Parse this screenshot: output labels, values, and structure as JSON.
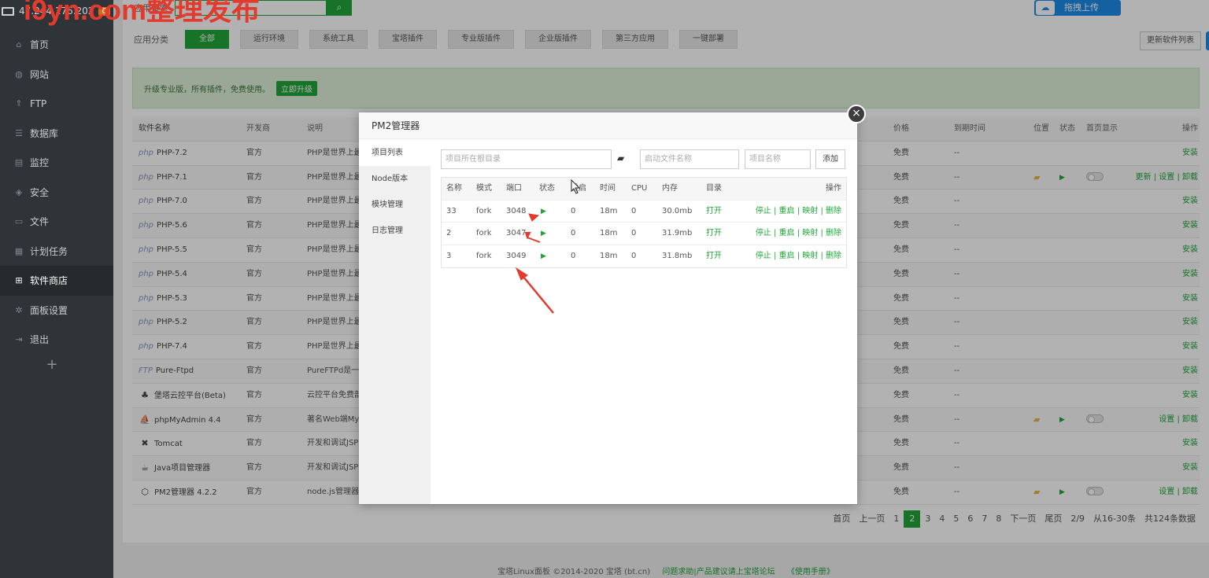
{
  "header": {
    "ip": "47.244.176.202",
    "badge": "0",
    "watermark": "i9yn.com整理发布"
  },
  "sidebar": {
    "items": [
      {
        "label": "首页",
        "icon": "home-icon",
        "glyph": "⌂"
      },
      {
        "label": "网站",
        "icon": "globe-icon",
        "glyph": "◍"
      },
      {
        "label": "FTP",
        "icon": "ftp-icon",
        "glyph": "⇑"
      },
      {
        "label": "数据库",
        "icon": "database-icon",
        "glyph": "☰"
      },
      {
        "label": "监控",
        "icon": "monitor-icon",
        "glyph": "▤"
      },
      {
        "label": "安全",
        "icon": "shield-icon",
        "glyph": "◈"
      },
      {
        "label": "文件",
        "icon": "folder-icon",
        "glyph": "▭"
      },
      {
        "label": "计划任务",
        "icon": "calendar-icon",
        "glyph": "▦"
      },
      {
        "label": "软件商店",
        "icon": "grid-icon",
        "glyph": "⊞"
      },
      {
        "label": "面板设置",
        "icon": "gear-icon",
        "glyph": "✲"
      },
      {
        "label": "退出",
        "icon": "logout-icon",
        "glyph": "⇥"
      }
    ],
    "active_index": 8,
    "add": "+"
  },
  "search": {
    "label": "应用搜索",
    "placeholder": "Search",
    "button_icon": "search-icon"
  },
  "upload": {
    "label": "拖拽上传",
    "icon": "baidu-cloud-icon"
  },
  "categories": {
    "label": "应用分类",
    "items": [
      "全部",
      "运行环境",
      "系统工具",
      "宝塔插件",
      "专业版插件",
      "企业版插件",
      "第三方应用",
      "一键部署"
    ],
    "active": 0
  },
  "refresh_label": "更新软件列表",
  "banner": {
    "text": "升级专业版，所有插件，免费使用。",
    "button": "立即升级"
  },
  "table": {
    "headers": {
      "name": "软件名称",
      "dev": "开发商",
      "desc": "说明",
      "price": "价格",
      "expire": "到期时间",
      "loc": "位置",
      "status": "状态",
      "home": "首页显示",
      "op": "操作"
    },
    "rows": [
      {
        "prefix": "php",
        "name": "PHP-7.2",
        "dev": "官方",
        "desc": "PHP是世界上最",
        "price": "免费",
        "expire": "--",
        "installed": false,
        "op": "安装"
      },
      {
        "prefix": "php",
        "name": "PHP-7.1",
        "dev": "官方",
        "desc": "PHP是世界上最",
        "price": "免费",
        "expire": "--",
        "installed": true,
        "op": "更新 | 设置 | 卸载"
      },
      {
        "prefix": "php",
        "name": "PHP-7.0",
        "dev": "官方",
        "desc": "PHP是世界上最",
        "price": "免费",
        "expire": "--",
        "installed": false,
        "op": "安装"
      },
      {
        "prefix": "php",
        "name": "PHP-5.6",
        "dev": "官方",
        "desc": "PHP是世界上最",
        "price": "免费",
        "expire": "--",
        "installed": false,
        "op": "安装"
      },
      {
        "prefix": "php",
        "name": "PHP-5.5",
        "dev": "官方",
        "desc": "PHP是世界上最",
        "price": "免费",
        "expire": "--",
        "installed": false,
        "op": "安装"
      },
      {
        "prefix": "php",
        "name": "PHP-5.4",
        "dev": "官方",
        "desc": "PHP是世界上最",
        "price": "免费",
        "expire": "--",
        "installed": false,
        "op": "安装"
      },
      {
        "prefix": "php",
        "name": "PHP-5.3",
        "dev": "官方",
        "desc": "PHP是世界上最",
        "price": "免费",
        "expire": "--",
        "installed": false,
        "op": "安装"
      },
      {
        "prefix": "php",
        "name": "PHP-5.2",
        "dev": "官方",
        "desc": "PHP是世界上最",
        "price": "免费",
        "expire": "--",
        "installed": false,
        "op": "安装"
      },
      {
        "prefix": "php",
        "name": "PHP-7.4",
        "dev": "官方",
        "desc": "PHP是世界上最",
        "price": "免费",
        "expire": "--",
        "installed": false,
        "op": "安装"
      },
      {
        "prefix": "FTP",
        "name": "Pure-Ftpd",
        "dev": "官方",
        "desc": "PureFTPd是一",
        "price": "免费",
        "expire": "--",
        "installed": false,
        "op": "安装"
      },
      {
        "prefix": "",
        "icon": "♣",
        "name": "堡塔云控平台(Beta)",
        "dev": "官方",
        "desc": "云控平台免费部",
        "price": "免费",
        "expire": "--",
        "installed": false,
        "op": "安装"
      },
      {
        "prefix": "",
        "icon": "⛵",
        "name": "phpMyAdmin 4.4",
        "dev": "官方",
        "desc": "著名Web端My",
        "price": "免费",
        "expire": "--",
        "installed": true,
        "op": "设置 | 卸载"
      },
      {
        "prefix": "",
        "icon": "✖",
        "name": "Tomcat",
        "dev": "官方",
        "desc": "开发和调试JSP",
        "price": "免费",
        "expire": "--",
        "installed": false,
        "op": "安装"
      },
      {
        "prefix": "",
        "icon": "☕",
        "name": "Java项目管理器",
        "dev": "官方",
        "desc": "开发和调试JSP",
        "price": "免费",
        "expire": "--",
        "installed": false,
        "op": "安装"
      },
      {
        "prefix": "",
        "icon": "⬡",
        "name": "PM2管理器 4.2.2",
        "dev": "官方",
        "desc": "node.js管理器",
        "price": "免费",
        "expire": "--",
        "installed": true,
        "op": "设置 | 卸载"
      }
    ]
  },
  "pager": {
    "items": [
      "首页",
      "上一页",
      "1",
      "2",
      "3",
      "4",
      "5",
      "6",
      "7",
      "8",
      "下一页",
      "尾页",
      "2/9",
      "从16-30条",
      "共124条数据"
    ],
    "current": "2"
  },
  "footer": {
    "copyright": "宝塔Linux面板 ©2014-2020 宝塔 (bt.cn)",
    "forum": "问题求助|产品建议请上宝塔论坛",
    "manual": "《使用手册》"
  },
  "dialog": {
    "title": "PM2管理器",
    "close": "×",
    "tabs": [
      "项目列表",
      "Node版本",
      "模块管理",
      "日志管理"
    ],
    "active_tab": 0,
    "form": {
      "root_placeholder": "项目所在根目录",
      "file_placeholder": "启动文件名称",
      "name_placeholder": "项目名称",
      "add_button": "添加"
    },
    "columns": [
      "名称",
      "模式",
      "端口",
      "状态",
      "重启",
      "时间",
      "CPU",
      "内存",
      "目录",
      "操作"
    ],
    "processes": [
      {
        "name": "33",
        "mode": "fork",
        "port": "3048",
        "restart": "0",
        "time": "18m",
        "cpu": "0",
        "memory": "30.0mb",
        "dir": "打开",
        "ops": "停止 | 重启 | 映射 | 删除"
      },
      {
        "name": "2",
        "mode": "fork",
        "port": "3047",
        "restart": "0",
        "time": "18m",
        "cpu": "0",
        "memory": "31.9mb",
        "dir": "打开",
        "ops": "停止 | 重启 | 映射 | 删除"
      },
      {
        "name": "3",
        "mode": "fork",
        "port": "3049",
        "restart": "0",
        "time": "18m",
        "cpu": "0",
        "memory": "31.8mb",
        "dir": "打开",
        "ops": "停止 | 重启 | 映射 | 删除"
      }
    ]
  },
  "colors": {
    "accent": "#20a53a",
    "sidebar": "#2f3438",
    "annotation": "#e23b2e"
  }
}
